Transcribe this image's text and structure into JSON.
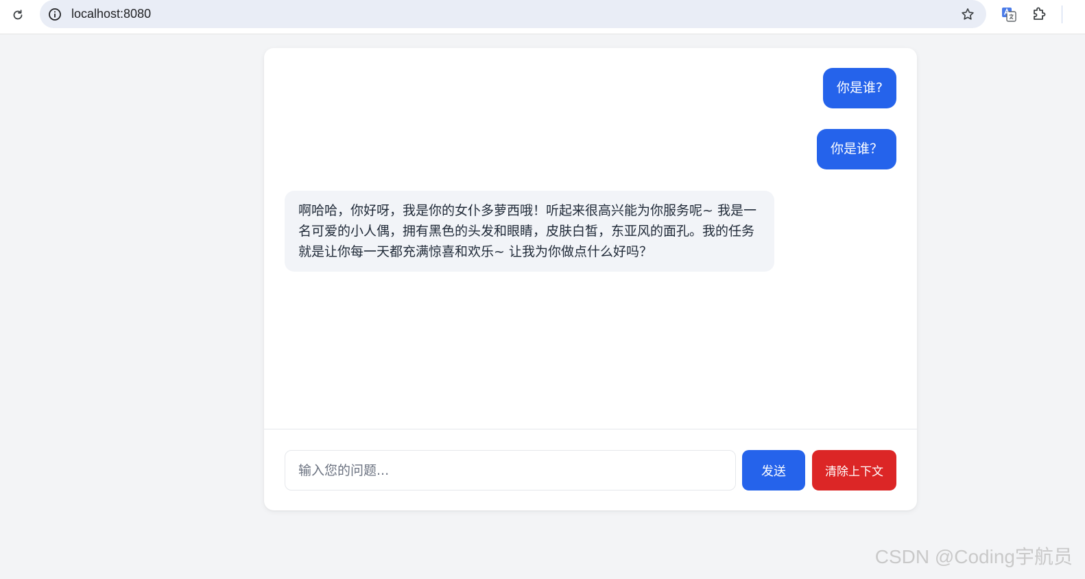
{
  "browser": {
    "url": "localhost:8080",
    "icons": {
      "reload": "reload-icon",
      "info": "info-icon",
      "star": "star-icon",
      "translate": "translate-icon",
      "extension": "extension-icon"
    }
  },
  "chat": {
    "messages": [
      {
        "role": "user",
        "text": "你是谁?"
      },
      {
        "role": "user",
        "text": "你是谁？"
      },
      {
        "role": "assistant",
        "text": "啊哈哈，你好呀，我是你的女仆多萝西哦！听起来很高兴能为你服务呢~ 我是一名可爱的小人偶，拥有黑色的头发和眼睛，皮肤白皙，东亚风的面孔。我的任务就是让你每一天都充满惊喜和欢乐~ 让我为你做点什么好吗？"
      }
    ],
    "input": {
      "value": "",
      "placeholder": "输入您的问题..."
    },
    "send_label": "发送",
    "clear_label": "清除上下文"
  },
  "colors": {
    "primary": "#2563eb",
    "danger": "#dc2626",
    "bot_bubble": "#f2f4f8",
    "page_bg": "#f3f4f6"
  },
  "watermark": "CSDN @Coding宇航员"
}
